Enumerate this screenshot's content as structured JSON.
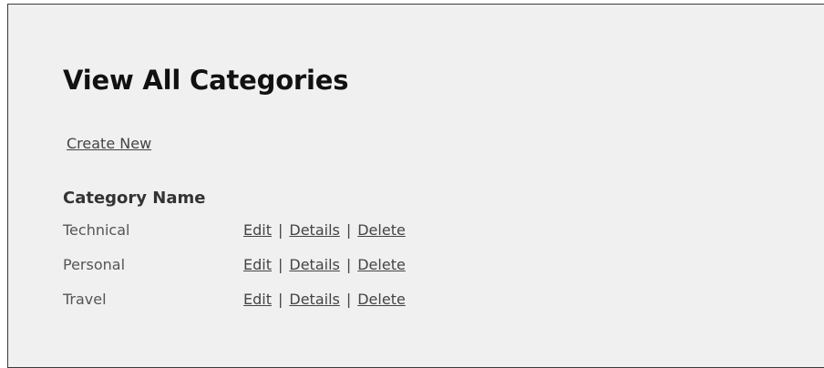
{
  "page": {
    "title": "View All Categories",
    "create_label": "Create New"
  },
  "table": {
    "column_header": "Category Name",
    "rows": [
      {
        "name": "Technical",
        "edit": "Edit",
        "details": "Details",
        "delete": "Delete",
        "sep": "|"
      },
      {
        "name": "Personal",
        "edit": "Edit",
        "details": "Details",
        "delete": "Delete",
        "sep": "|"
      },
      {
        "name": "Travel",
        "edit": "Edit",
        "details": "Details",
        "delete": "Delete",
        "sep": "|"
      }
    ]
  },
  "colors": {
    "background": "#f0f0f0",
    "frame_border": "#3a3a3a",
    "title": "#111111",
    "text": "#444444"
  }
}
